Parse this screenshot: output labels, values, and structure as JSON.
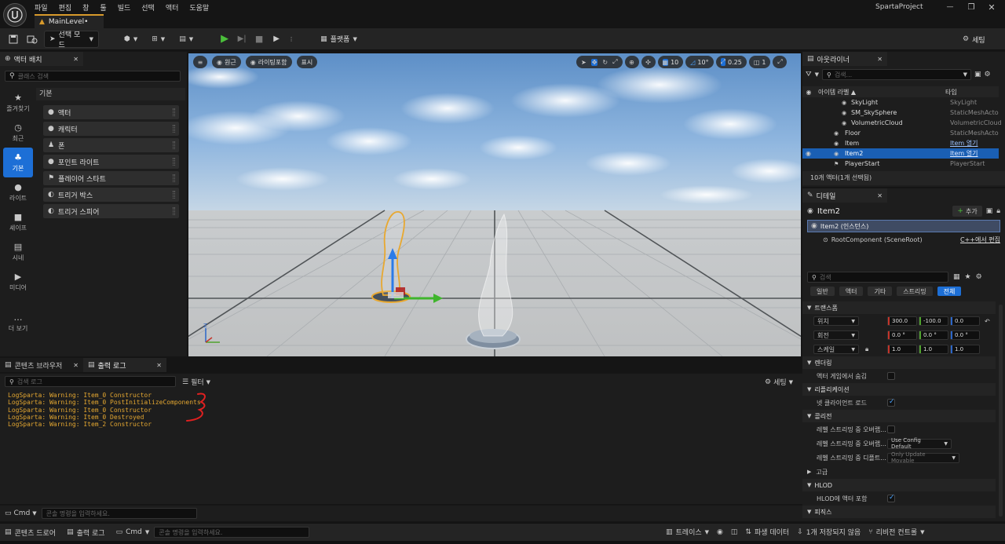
{
  "app": {
    "project_name": "SpartaProject",
    "menu": [
      "파일",
      "편집",
      "창",
      "툴",
      "빌드",
      "선택",
      "액터",
      "도움말"
    ],
    "document_tab": "MainLevel•"
  },
  "toolbar": {
    "mode_label": "선택 모드",
    "platform_label": "플랫폼",
    "settings_label": "세팅"
  },
  "place_actors": {
    "tab_label": "액터 배치",
    "search_placeholder": "클래스 검색",
    "categories": [
      {
        "label": "즐겨찾기",
        "icon": "star-icon"
      },
      {
        "label": "최근",
        "icon": "clock-icon"
      },
      {
        "label": "기본",
        "icon": "shapes-icon"
      },
      {
        "label": "라이트",
        "icon": "light-bulb-icon"
      },
      {
        "label": "셰이프",
        "icon": "cube-icon"
      },
      {
        "label": "시네",
        "icon": "clapper-icon"
      },
      {
        "label": "미디어",
        "icon": "media-icon"
      },
      {
        "label": "더 보기",
        "icon": "more-icon"
      }
    ],
    "section_header": "기본",
    "items": [
      "액터",
      "캐릭터",
      "폰",
      "포인트 라이트",
      "플레이어 스타트",
      "트리거 박스",
      "트리거 스피어"
    ]
  },
  "viewport": {
    "view_mode": "원근",
    "lighting": "라이팅포함",
    "show": "표시",
    "grid_snap": "10",
    "rotation_snap": "10°",
    "scale_snap": "0.25",
    "camera_speed": "1"
  },
  "outliner": {
    "tab_label": "아웃라이너",
    "search_placeholder": "검색...",
    "col_label": "아이템 라벨 ▲",
    "col_type": "타입",
    "rows": [
      {
        "name": "SkyLight",
        "type": "SkyLight"
      },
      {
        "name": "SM_SkySphere",
        "type": "StaticMeshActo"
      },
      {
        "name": "VolumetricCloud",
        "type": "VolumetricCloud"
      },
      {
        "name": "Floor",
        "type": "StaticMeshActo"
      },
      {
        "name": "Item",
        "type": "Item 열기"
      },
      {
        "name": "Item2",
        "type": "Item 열기"
      },
      {
        "name": "PlayerStart",
        "type": "PlayerStart"
      }
    ],
    "footer": "10개 액터(1개 선택됨)"
  },
  "details": {
    "tab_label": "디테일",
    "actor_name": "Item2",
    "add_label": "추가",
    "instance_label": "Item2 (인스턴스)",
    "root_component": "RootComponent (SceneRoot)",
    "cpp_edit": "C++에서 편집",
    "search_placeholder": "검색",
    "filter_tabs": [
      "일반",
      "액터",
      "기타",
      "스트리밍",
      "전체"
    ],
    "transform": {
      "header": "트랜스폼",
      "location_label": "위치",
      "rotation_label": "회전",
      "scale_label": "스케일",
      "location": [
        "300.0",
        "-100.0",
        "0.0"
      ],
      "rotation": [
        "0.0 °",
        "0.0 °",
        "0.0 °"
      ],
      "scale": [
        "1.0",
        "1.0",
        "1.0"
      ]
    },
    "rendering": {
      "header": "렌더링",
      "hidden_label": "액터 게임에서 숨김"
    },
    "replication": {
      "header": "리플리케이션",
      "net_load_label": "넷 클라이언트 로드"
    },
    "collision": {
      "header": "콜리전",
      "row1": "레벨 스트리밍 중 오버랩...",
      "row2": "레벨 스트리밍 중 오버랩...",
      "row2_value": "Use Config Default",
      "row3": "레벨 스트리밍 중 디플트...",
      "row3_value": "Only Update Movable"
    },
    "advanced_label": "고급",
    "hlod": {
      "header": "HLOD",
      "include_label": "HLOD에 액터 포함"
    },
    "physics_header": "피직스"
  },
  "output": {
    "tab_content_browser": "콘텐츠 브라우저",
    "tab_output_log": "출력 로그",
    "search_placeholder": "검색 로그",
    "filter_label": "필터",
    "settings_label": "세팅",
    "lines": [
      "LogSparta: Warning: Item_0 Constructor",
      "LogSparta: Warning: Item_0 PostInitializeComponents",
      "LogSparta: Warning: Item_0 Constructor",
      "LogSparta: Warning: Item_0 Destroyed",
      "LogSparta: Warning: Item_2 Constructor"
    ],
    "cmd_label": "Cmd",
    "cmd_placeholder": "콘솔 명령을 입력하세요."
  },
  "statusbar": {
    "content_drawer": "콘텐츠 드로어",
    "output_log": "출력 로그",
    "cmd_label": "Cmd",
    "cmd_placeholder": "콘솔 명령을 입력하세요.",
    "trace": "트레이스",
    "derived_data": "파생 데이터",
    "unsaved": "1개 저장되지 않음",
    "revision": "리비전 컨트롤"
  },
  "colors": {
    "accent_blue": "#1d6fd6",
    "selection_blue": "#1a5fb4",
    "log_warning": "#e4a731",
    "tab_accent": "#d89a2b",
    "play_green": "#4bbf3b"
  }
}
